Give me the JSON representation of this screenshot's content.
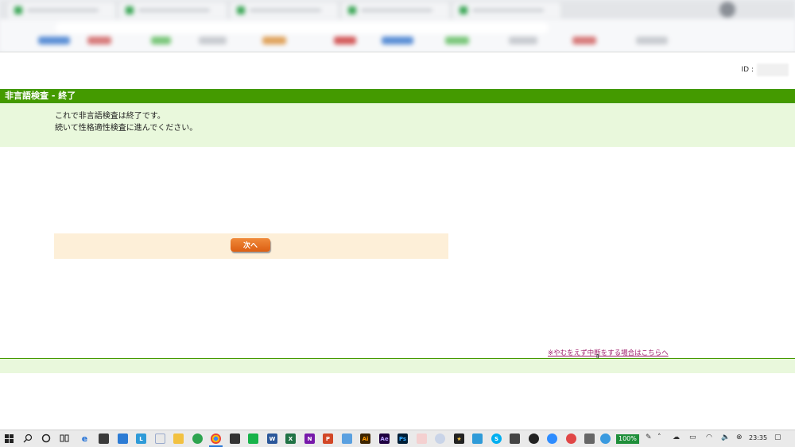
{
  "page": {
    "id_label": "ID :",
    "title": "非言語検査 - 終了",
    "message": {
      "line1": "これで非言語検査は終了です。",
      "line2": "続いて性格適性検査に進んでください。"
    },
    "next_button_label": "次へ",
    "interrupt_link": "※やむをえず中断をする場合はこちらへ"
  },
  "taskbar": {
    "battery_percent": "100%",
    "clock": "23:35"
  },
  "colors": {
    "accent_green": "#449a00",
    "message_bg": "#e9f8dc",
    "panel_bg": "#fdefd8",
    "button_orange": "#e06a1e",
    "link_magenta": "#a0226e"
  }
}
